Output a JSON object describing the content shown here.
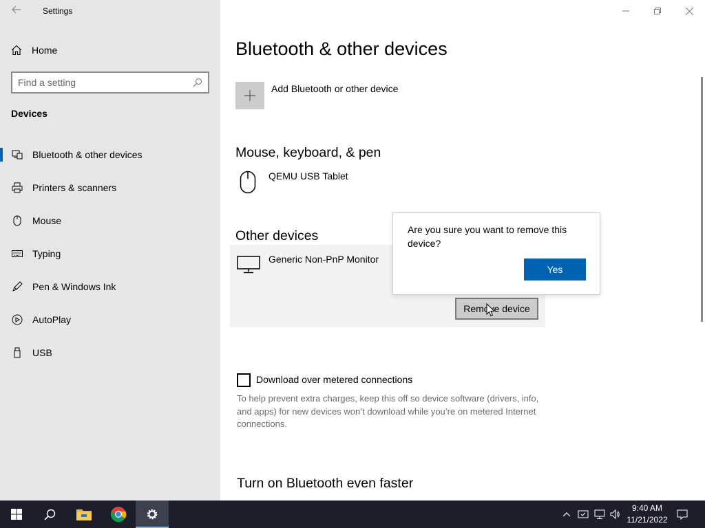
{
  "window": {
    "title": "Settings"
  },
  "sidebar": {
    "home_label": "Home",
    "search_placeholder": "Find a setting",
    "section_label": "Devices",
    "items": [
      {
        "label": "Bluetooth & other devices",
        "icon": "bluetooth-devices-icon",
        "active": true
      },
      {
        "label": "Printers & scanners",
        "icon": "printer-icon",
        "active": false
      },
      {
        "label": "Mouse",
        "icon": "mouse-icon",
        "active": false
      },
      {
        "label": "Typing",
        "icon": "keyboard-icon",
        "active": false
      },
      {
        "label": "Pen & Windows Ink",
        "icon": "pen-icon",
        "active": false
      },
      {
        "label": "AutoPlay",
        "icon": "autoplay-icon",
        "active": false
      },
      {
        "label": "USB",
        "icon": "usb-icon",
        "active": false
      }
    ]
  },
  "main": {
    "title": "Bluetooth & other devices",
    "add_device_label": "Add Bluetooth or other device",
    "mouse_section_title": "Mouse, keyboard, & pen",
    "mouse_device_name": "QEMU USB Tablet",
    "other_section_title": "Other devices",
    "other_device_name": "Generic Non-PnP Monitor",
    "remove_button_label": "Remove device",
    "metered_label": "Download over metered connections",
    "metered_checked": false,
    "metered_help": "To help prevent extra charges, keep this off so device software (drivers, info, and apps) for new devices won’t download while you’re on metered Internet connections.",
    "bottom_section_title": "Turn on Bluetooth even faster"
  },
  "dialog": {
    "message": "Are you sure you want to remove this device?",
    "yes_label": "Yes"
  },
  "taskbar": {
    "time": "9:40 AM",
    "date": "11/21/2022"
  },
  "colors": {
    "accent": "#0063b1",
    "sidebar_bg": "#e6e6e6",
    "taskbar_bg": "#1e1e2a"
  }
}
